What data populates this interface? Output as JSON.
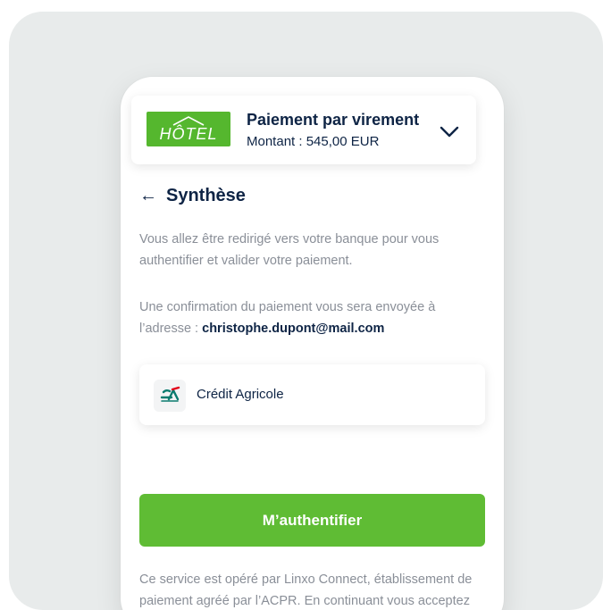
{
  "merchant": {
    "logo_text": "HÔTEL",
    "payment_title": "Paiement par virement",
    "amount_text": "Montant : 545,00 EUR"
  },
  "summary": {
    "back_icon": "←",
    "title": "Synthèse",
    "redirect_text": "Vous allez être redirigé vers votre banque pour vous authentifier et valider votre paiement.",
    "confirmation_prefix": "Une confirmation du paiement vous sera envoyée à l’adresse : ",
    "email": "christophe.dupont@mail.com"
  },
  "bank": {
    "name": "Crédit Agricole",
    "icon": "credit-agricole-logo"
  },
  "auth_button": {
    "label": "M’authentifier"
  },
  "legal_text": "Ce service est opéré par Linxo Connect, établissement de paiement agréé par l’ACPR. En continuant vous acceptez les conditions générales de Linxo Connect.",
  "colors": {
    "accent_green": "#5fbc34",
    "navy": "#0e2445",
    "muted": "#8a8f98",
    "background": "#e8ebeb"
  }
}
